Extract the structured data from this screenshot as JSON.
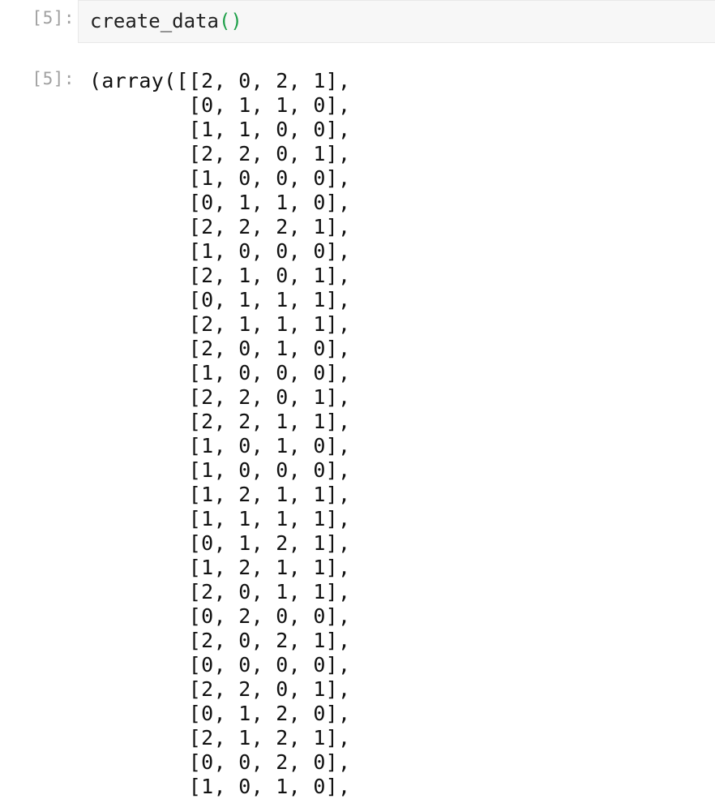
{
  "input": {
    "prompt": "[5]:",
    "func_name": "create_data",
    "parens": "()"
  },
  "output": {
    "prompt": "[5]:",
    "array_rows": [
      [
        2,
        0,
        2,
        1
      ],
      [
        0,
        1,
        1,
        0
      ],
      [
        1,
        1,
        0,
        0
      ],
      [
        2,
        2,
        0,
        1
      ],
      [
        1,
        0,
        0,
        0
      ],
      [
        0,
        1,
        1,
        0
      ],
      [
        2,
        2,
        2,
        1
      ],
      [
        1,
        0,
        0,
        0
      ],
      [
        2,
        1,
        0,
        1
      ],
      [
        0,
        1,
        1,
        1
      ],
      [
        2,
        1,
        1,
        1
      ],
      [
        2,
        0,
        1,
        0
      ],
      [
        1,
        0,
        0,
        0
      ],
      [
        2,
        2,
        0,
        1
      ],
      [
        2,
        2,
        1,
        1
      ],
      [
        1,
        0,
        1,
        0
      ],
      [
        1,
        0,
        0,
        0
      ],
      [
        1,
        2,
        1,
        1
      ],
      [
        1,
        1,
        1,
        1
      ],
      [
        0,
        1,
        2,
        1
      ],
      [
        1,
        2,
        1,
        1
      ],
      [
        2,
        0,
        1,
        1
      ],
      [
        0,
        2,
        0,
        0
      ],
      [
        2,
        0,
        2,
        1
      ],
      [
        0,
        0,
        0,
        0
      ],
      [
        2,
        2,
        0,
        1
      ],
      [
        0,
        1,
        2,
        0
      ],
      [
        2,
        1,
        2,
        1
      ],
      [
        0,
        0,
        2,
        0
      ],
      [
        1,
        0,
        1,
        0
      ]
    ]
  }
}
